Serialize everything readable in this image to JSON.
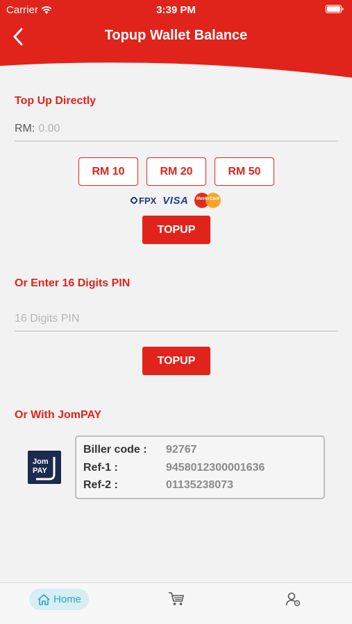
{
  "status_bar": {
    "carrier": "Carrier",
    "time": "3:39 PM"
  },
  "header": {
    "title": "Topup Wallet Balance",
    "color": "#e0241b"
  },
  "direct": {
    "section_title": "Top Up Directly",
    "amount_prefix": "RM:",
    "amount_placeholder": "0.00",
    "quick_amounts": [
      "RM 10",
      "RM 20",
      "RM 50"
    ],
    "payment_logos": {
      "fpx": "FPX",
      "visa": "VISA",
      "mastercard": "MasterCard"
    },
    "topup_label": "TOPUP"
  },
  "pin": {
    "section_title": "Or Enter 16 Digits PIN",
    "placeholder": "16 Digits PIN",
    "topup_label": "TOPUP"
  },
  "jompay": {
    "section_title": "Or With JomPAY",
    "logo_text_top": "Jom",
    "logo_text_bottom": "PAY",
    "rows": [
      {
        "label": "Biller code :",
        "value": "92767"
      },
      {
        "label": "Ref-1 :",
        "value": "9458012300001636"
      },
      {
        "label": "Ref-2 :",
        "value": "01135238073"
      }
    ]
  },
  "tabbar": {
    "home_label": "Home",
    "accent": "#27a6c8",
    "icons": [
      "home-icon",
      "cart-icon",
      "profile-icon"
    ]
  }
}
